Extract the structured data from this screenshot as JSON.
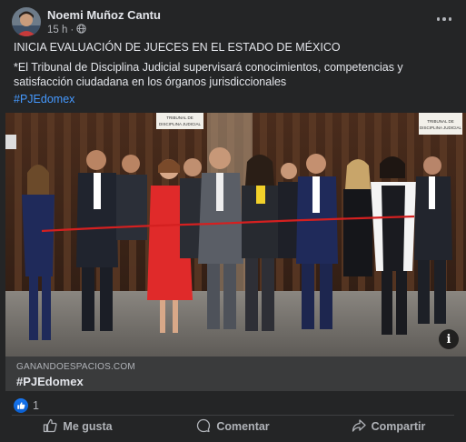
{
  "post": {
    "author": "Noemi Muñoz Cantu",
    "time": "15 h",
    "audience_icon": "globe-icon",
    "text_line1": "INICIA EVALUACIÓN DE JUECES EN EL ESTADO DE MÉXICO",
    "text_line2": "*El Tribunal de Disciplina Judicial supervisará conocimientos, competencias y satisfacción ciudadana en los órganos jurisdiccionales",
    "hashtag": "#PJEdomex"
  },
  "photo": {
    "sign_left": "TRIBUNAL DE DISCIPLINA JUDICIAL",
    "sign_right": "TRIBUNAL DE DISCIPLINA JUDICIAL",
    "info_label": "i"
  },
  "link": {
    "domain": "GANANDOESPACIOS.COM",
    "title": "#PJEdomex"
  },
  "reactions": {
    "count": "1",
    "icon": "like-reaction-icon"
  },
  "actions": {
    "like": "Me gusta",
    "comment": "Comentar",
    "share": "Compartir"
  },
  "colors": {
    "background": "#242526",
    "link_bar": "#3a3b3c",
    "hashtag": "#4599ff",
    "like_blue": "#1877f2"
  }
}
